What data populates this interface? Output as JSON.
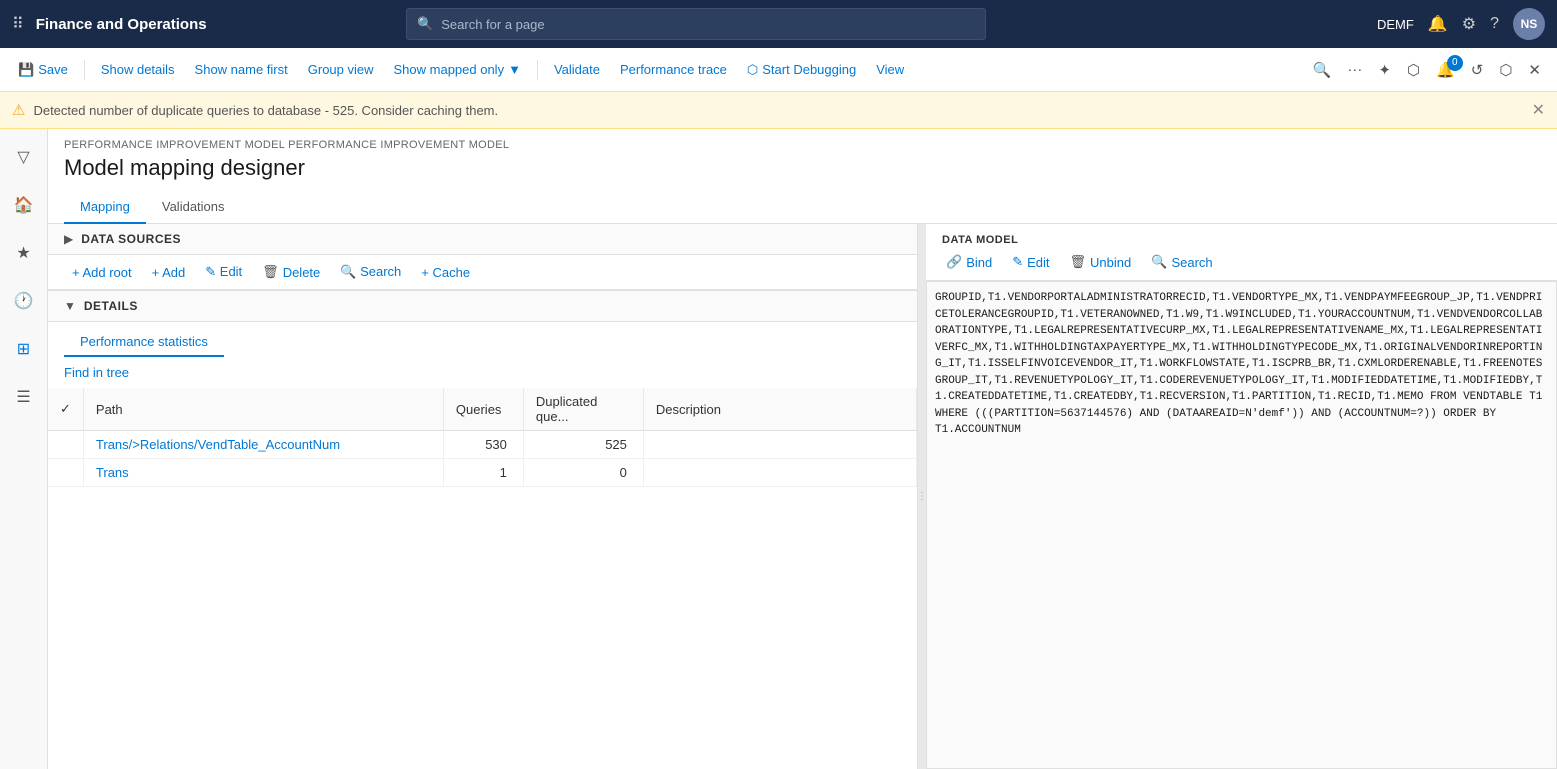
{
  "topbar": {
    "app_title": "Finance and Operations",
    "search_placeholder": "Search for a page",
    "user_code": "DEMF",
    "user_initials": "NS"
  },
  "toolbar": {
    "save_label": "Save",
    "show_details_label": "Show details",
    "show_name_first_label": "Show name first",
    "group_view_label": "Group view",
    "show_mapped_only_label": "Show mapped only",
    "validate_label": "Validate",
    "performance_trace_label": "Performance trace",
    "start_debugging_label": "Start Debugging",
    "view_label": "View",
    "notification_count": "0"
  },
  "warning": {
    "message": "Detected number of duplicate queries to database - 525. Consider caching them."
  },
  "breadcrumb": "PERFORMANCE IMPROVEMENT MODEL PERFORMANCE IMPROVEMENT MODEL",
  "page_title": "Model mapping designer",
  "tabs": [
    {
      "label": "Mapping",
      "active": true
    },
    {
      "label": "Validations",
      "active": false
    }
  ],
  "data_sources": {
    "section_title": "DATA SOURCES",
    "toolbar_buttons": [
      {
        "label": "+ Add root"
      },
      {
        "label": "+ Add"
      },
      {
        "label": "✎ Edit"
      },
      {
        "label": "🗑 Delete"
      },
      {
        "label": "🔍 Search"
      },
      {
        "label": "+ Cache"
      }
    ],
    "search_placeholder": "Search"
  },
  "details": {
    "section_title": "DETAILS",
    "tab_label": "Performance statistics",
    "find_in_tree_label": "Find in tree",
    "table": {
      "columns": [
        "",
        "Path",
        "Queries",
        "Duplicated que...",
        "Description"
      ],
      "rows": [
        {
          "checked": false,
          "path": "Trans/>Relations/VendTable_AccountNum",
          "queries": "530",
          "duplicated": "525",
          "description": ""
        },
        {
          "checked": false,
          "path": "Trans",
          "queries": "1",
          "duplicated": "0",
          "description": ""
        }
      ]
    }
  },
  "data_model": {
    "label": "DATA MODEL",
    "buttons": [
      {
        "label": "Bind",
        "icon": "🔗"
      },
      {
        "label": "Edit",
        "icon": "✎"
      },
      {
        "label": "Unbind",
        "icon": "🗑"
      },
      {
        "label": "Search",
        "icon": "🔍"
      }
    ]
  },
  "sql_content": "GROUPID,T1.VENDORPORTALADMINISTRATORRECID,T1.VENDORTYPE_MX,T1.VENDPAYMFEEGROUP_JP,T1.VENDPRICETOLERANCEGROUPID,T1.VETERANOWNED,T1.W9,T1.W9INCLUDED,T1.YOURACCOUNTNUM,T1.VENDVENDORCOLLABORATIONTYPE,T1.LEGALREPRESENTATIVECURP_MX,T1.LEGALREPRESENTATIVENAME_MX,T1.LEGALREPRESENTATIVERFC_MX,T1.WITHHOLDINGTAXPAYERTYPE_MX,T1.WITHHOLDINGTYPECODE_MX,T1.ORIGINALVENDORINREPORTING_IT,T1.ISSELFINVOICEVENDOR_IT,T1.WORKFLOWSTATE,T1.ISCPRB_BR,T1.CXMLORDERENABLE,T1.FREENOTESGROUP_IT,T1.REVENUETYPOLOGY_IT,T1.CODEREVENUETYPOLOGY_IT,T1.MODIFIEDDATETIME,T1.MODIFIEDBY,T1.CREATEDDATETIME,T1.CREATEDBY,T1.RECVERSION,T1.PARTITION,T1.RECID,T1.MEMO FROM VENDTABLE T1 WHERE (((PARTITION=5637144576) AND (DATAAREAID=N'demf')) AND (ACCOUNTNUM=?)) ORDER BY T1.ACCOUNTNUM",
  "sidebar": {
    "icons": [
      {
        "name": "home",
        "symbol": "🏠"
      },
      {
        "name": "star",
        "symbol": "★"
      },
      {
        "name": "clock",
        "symbol": "🕐"
      },
      {
        "name": "grid",
        "symbol": "⊞"
      },
      {
        "name": "list",
        "symbol": "☰"
      }
    ]
  }
}
